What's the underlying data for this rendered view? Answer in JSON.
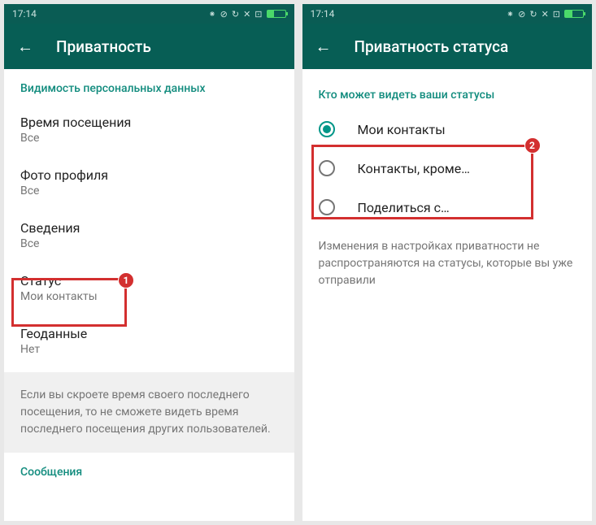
{
  "status_bar": {
    "time": "17:14",
    "bluetooth": "⁕",
    "dnd": "⊘",
    "sync": "↻",
    "sim": "✕",
    "box": "⊡"
  },
  "left": {
    "app_title": "Приватность",
    "section1": "Видимость персональных данных",
    "items": [
      {
        "title": "Время посещения",
        "sub": "Все"
      },
      {
        "title": "Фото профиля",
        "sub": "Все"
      },
      {
        "title": "Сведения",
        "sub": "Все"
      },
      {
        "title": "Статус",
        "sub": "Мои контакты"
      },
      {
        "title": "Геоданные",
        "sub": "Нет"
      }
    ],
    "info": "Если вы скроете время своего последнего посещения, то не сможете видеть время последнего посещения других пользователей.",
    "section2": "Сообщения",
    "badge1": "1"
  },
  "right": {
    "app_title": "Приватность статуса",
    "section": "Кто может видеть ваши статусы",
    "options": [
      {
        "label": "Мои контакты"
      },
      {
        "label": "Контакты, кроме…"
      },
      {
        "label": "Поделиться с…"
      }
    ],
    "note": "Изменения в настройках приватности не распространяются на статусы, которые вы уже отправили",
    "badge2": "2"
  }
}
